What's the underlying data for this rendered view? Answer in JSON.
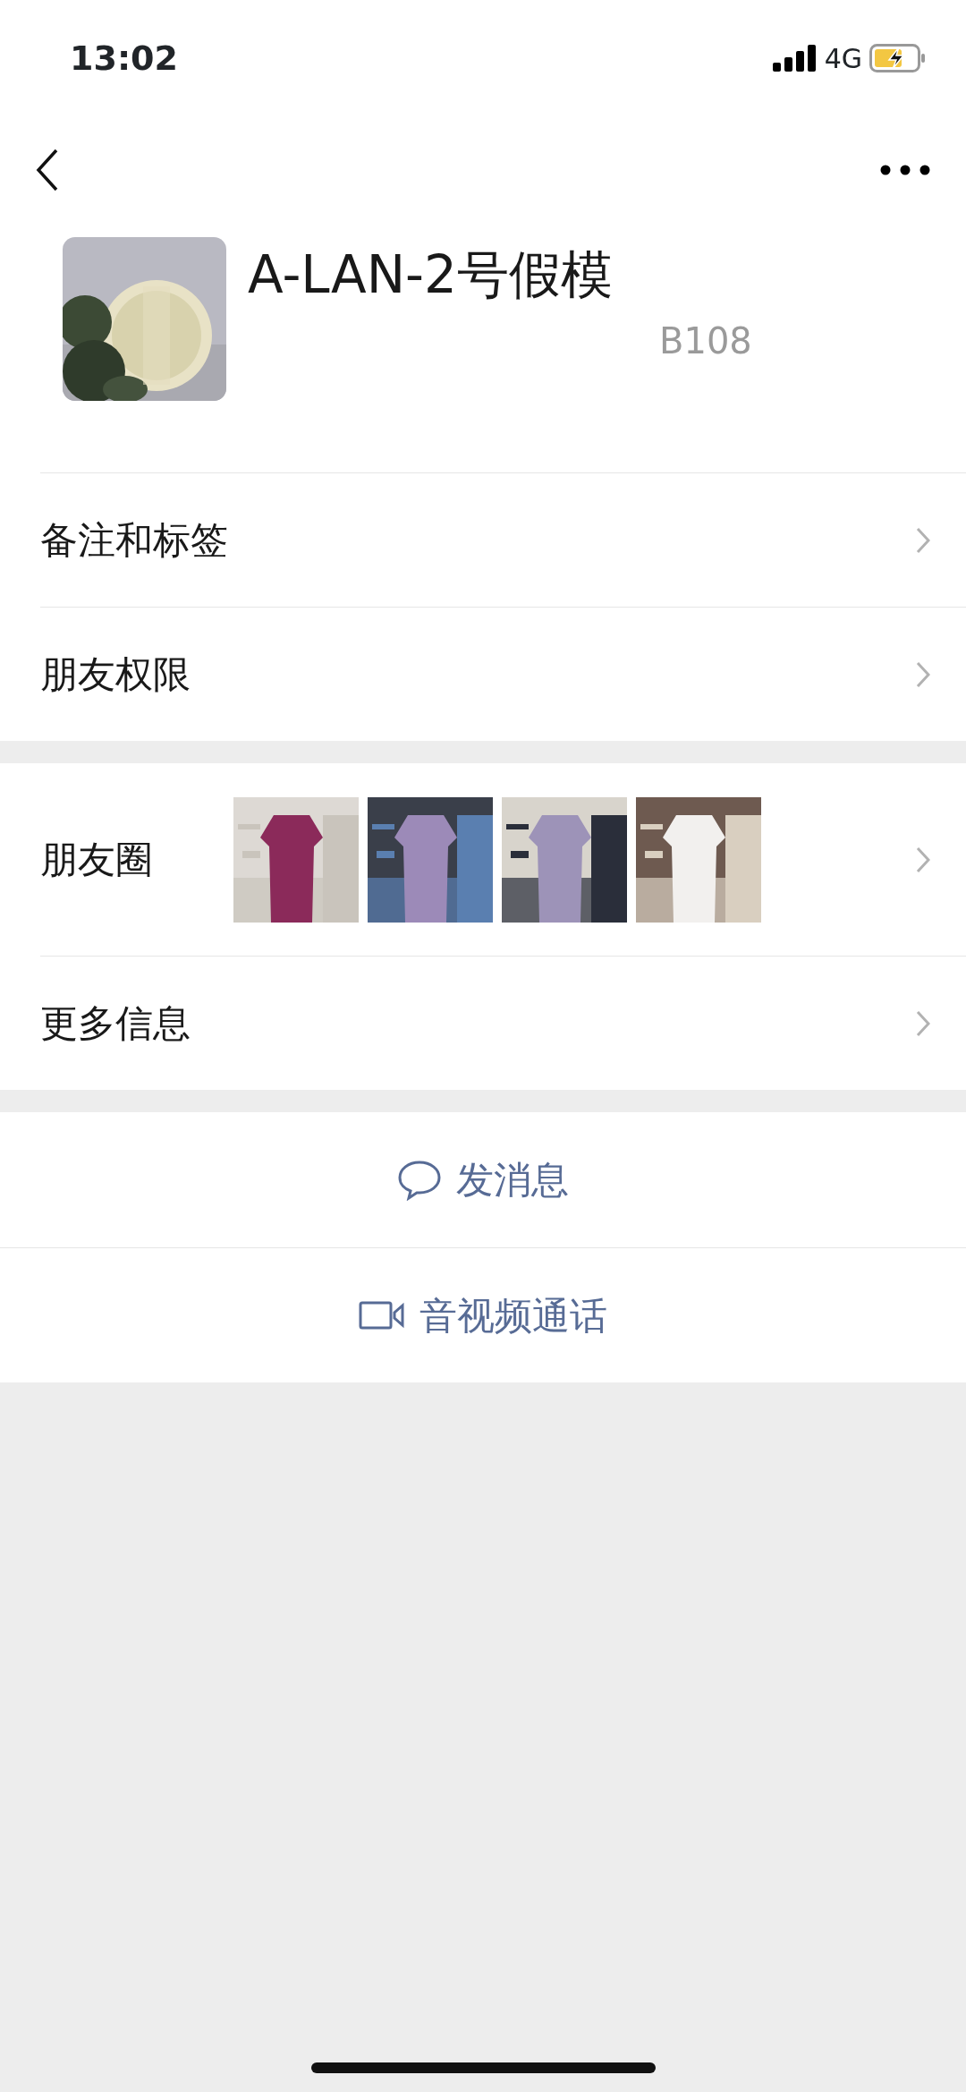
{
  "status_bar": {
    "time": "13:02",
    "network": "4G"
  },
  "profile": {
    "name": "A-LAN-2号假模",
    "subtitle": "B108"
  },
  "groups": [
    {
      "rows": [
        {
          "kind": "link",
          "label": "备注和标签"
        },
        {
          "kind": "link",
          "label": "朋友权限"
        }
      ]
    },
    {
      "rows": [
        {
          "kind": "moments",
          "label": "朋友圈"
        },
        {
          "kind": "link",
          "label": "更多信息"
        }
      ]
    }
  ],
  "actions": [
    {
      "kind": "message",
      "label": "发消息"
    },
    {
      "kind": "video",
      "label": "音视频通话"
    }
  ]
}
